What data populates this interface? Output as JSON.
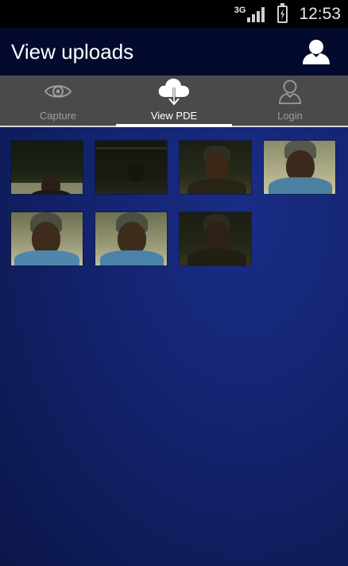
{
  "status_bar": {
    "network": "3G",
    "time": "12:53"
  },
  "action_bar": {
    "title": "View uploads",
    "user_icon": "user-icon"
  },
  "tabs": [
    {
      "label": "Capture",
      "icon": "eye-icon",
      "active": false
    },
    {
      "label": "View PDE",
      "icon": "cloud-download-icon",
      "active": true
    },
    {
      "label": "Login",
      "icon": "user-outline-icon",
      "active": false
    }
  ],
  "uploads": [
    {
      "image": "photo-thumbnail-1"
    },
    {
      "image": "photo-thumbnail-2"
    },
    {
      "image": "photo-thumbnail-3"
    },
    {
      "image": "photo-thumbnail-4"
    },
    {
      "image": "photo-thumbnail-5"
    },
    {
      "image": "photo-thumbnail-6"
    },
    {
      "image": "photo-thumbnail-7"
    }
  ],
  "colors": {
    "status_bar": "#000000",
    "action_bar": "#040a2d",
    "tab_bar": "#4a4a4a",
    "content_bg": "#13236e",
    "active_tab_indicator": "#ffffff"
  }
}
